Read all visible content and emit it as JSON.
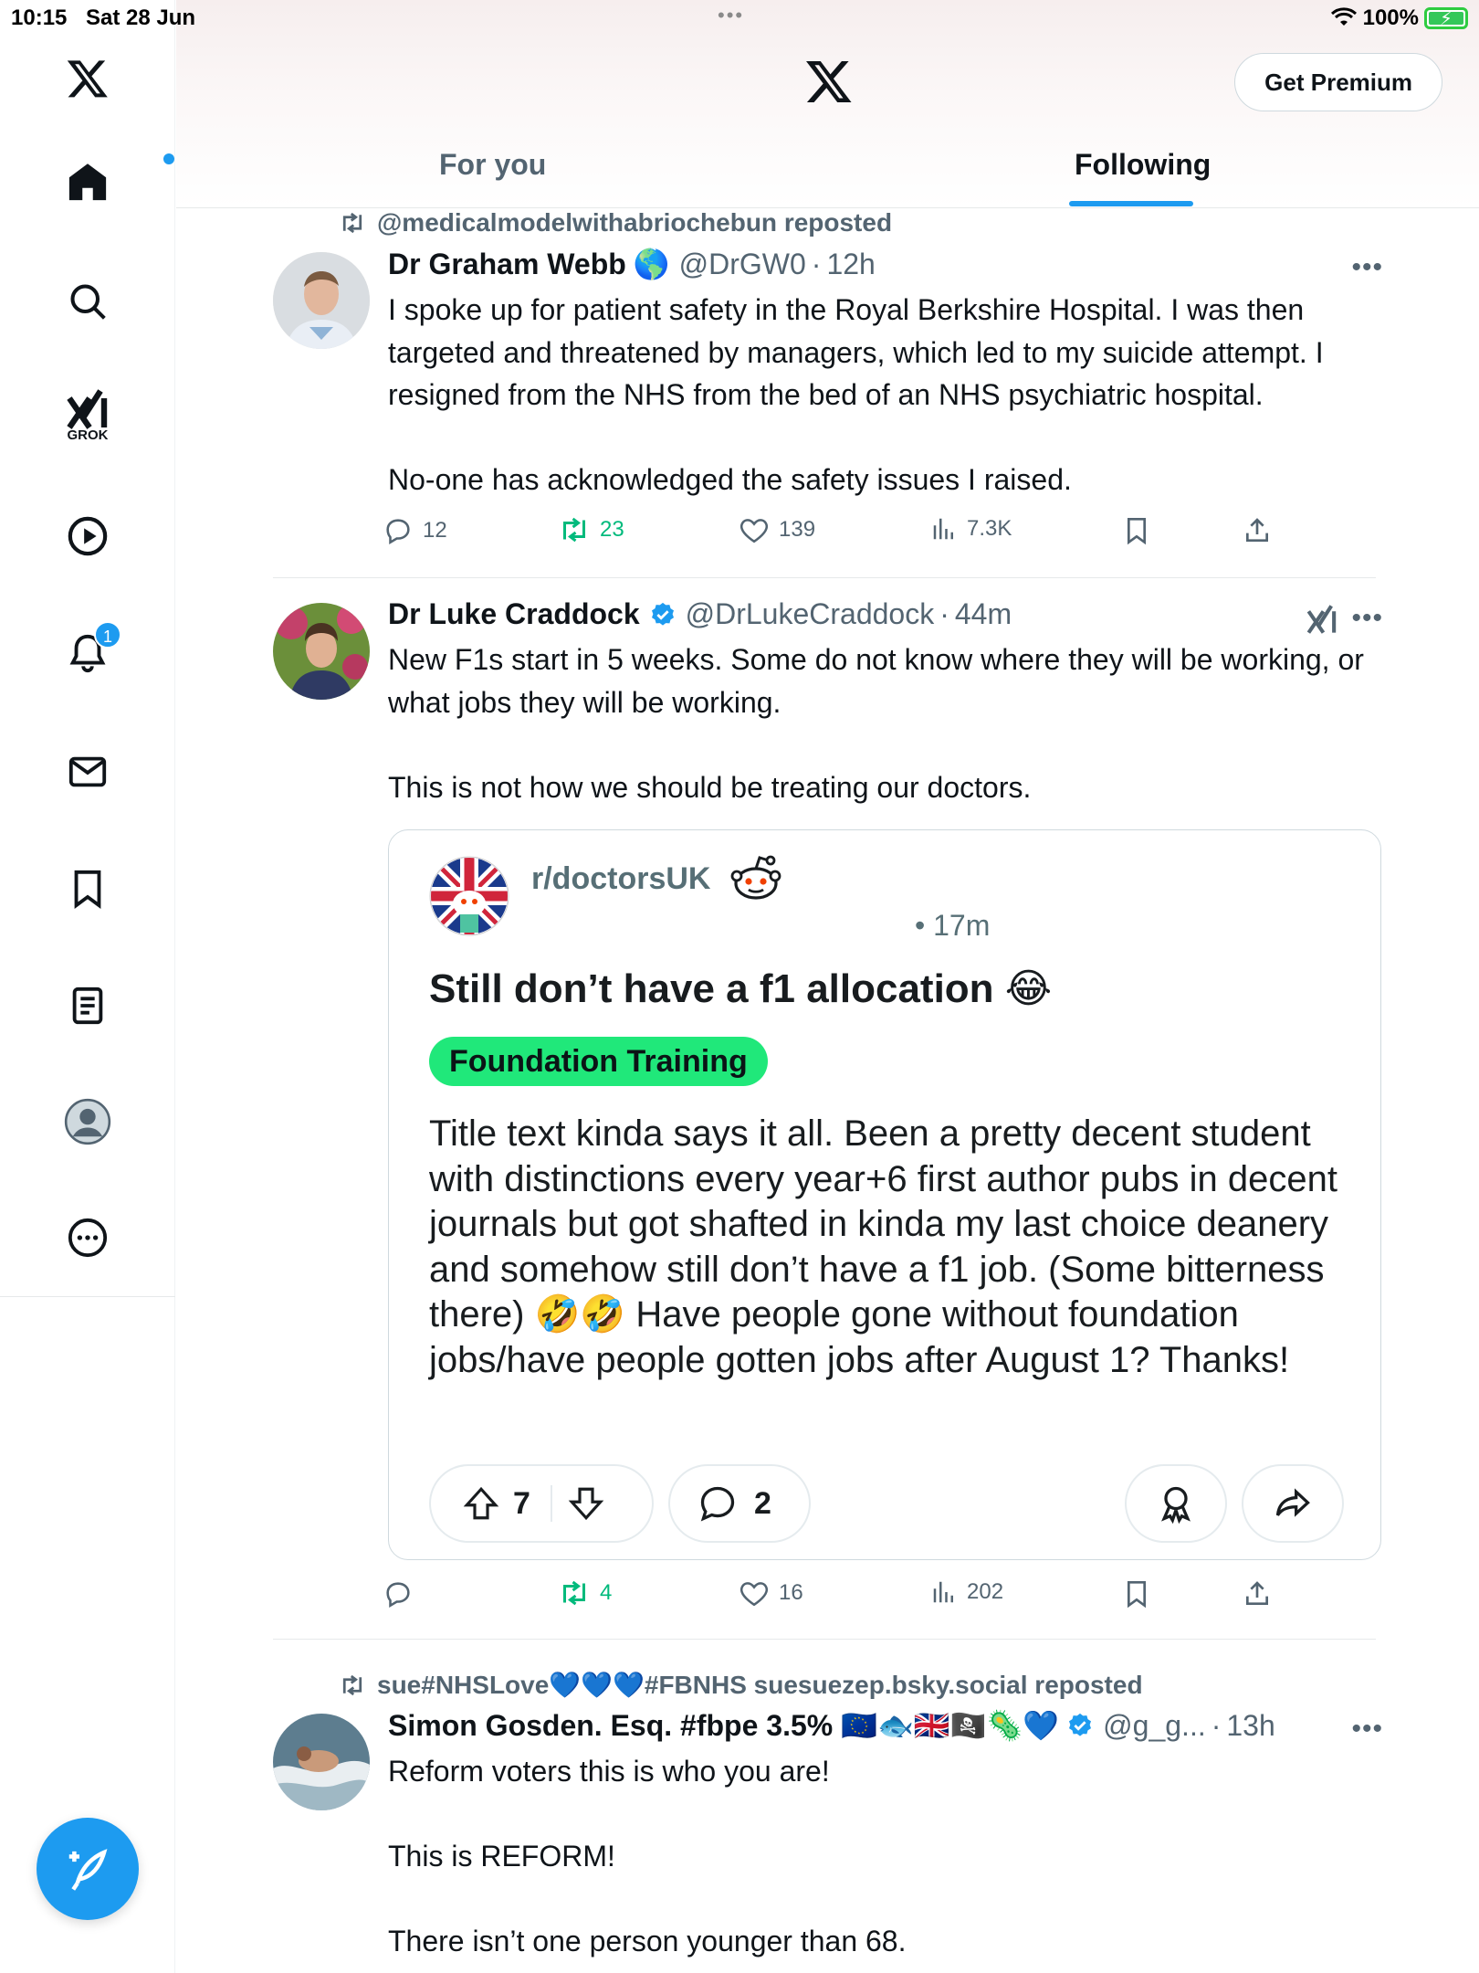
{
  "status_bar": {
    "time": "10:15",
    "date": "Sat 28 Jun",
    "battery": "100%"
  },
  "sidebar": {
    "grok_label": "GROK",
    "notifications_count": "1"
  },
  "header": {
    "premium_label": "Get Premium",
    "tabs": [
      {
        "label": "For you",
        "active": false
      },
      {
        "label": "Following",
        "active": true
      }
    ]
  },
  "posts": [
    {
      "repost_by": "@medicalmodelwithabriochebun reposted",
      "name": "Dr Graham Webb",
      "badge": "🌎",
      "handle": "@DrGW0",
      "time": "12h",
      "text": "I spoke up for patient safety in the Royal Berkshire Hospital. I was then targeted and threatened by managers, which led to my suicide attempt. I resigned from the NHS from the bed of an NHS psychiatric hospital.\n\nNo-one has acknowledged the safety issues I raised.",
      "replies": "12",
      "reposts": "23",
      "likes": "139",
      "views": "7.3K"
    },
    {
      "repost_by": "",
      "name": "Dr Luke Craddock",
      "handle": "@DrLukeCraddock",
      "time": "44m",
      "text": "New F1s start in 5 weeks. Some do not know where they will be working, or what jobs they will be working.\n\nThis is not how we should be treating our doctors.",
      "replies": "",
      "reposts": "4",
      "likes": "16",
      "views": "202",
      "embed": {
        "subreddit": "r/doctorsUK",
        "time": "• 17m",
        "title": "Still don’t have a f1 allocation 😂",
        "flair": "Foundation Training",
        "body": "Title text kinda says it all. Been a pretty decent student with distinctions every year+6 first author pubs in decent journals but got shafted in kinda my last choice deanery and somehow still don’t have a f1 job. (Some bitterness there) 🤣🤣 Have people gone without foundation jobs/have people gotten jobs after August 1? Thanks!",
        "upvotes": "7",
        "comments": "2"
      }
    },
    {
      "repost_by": "sue#NHSLove💙💙💙#FBNHS suesuezep.bsky.social reposted",
      "name": "Simon Gosden. Esq. #fbpe 3.5% 🇪🇺🐟🇬🇧🏴‍☠️🦠💙",
      "handle": "@g_g...",
      "time": "13h",
      "text": "Reform voters this is who you are!\n\nThis is REFORM!\n\nThere isn’t one person younger than 68."
    }
  ]
}
